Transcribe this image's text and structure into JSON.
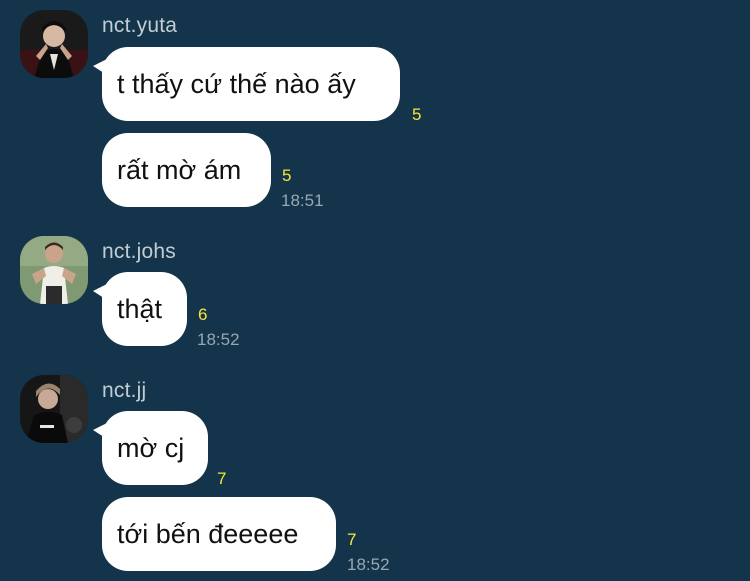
{
  "messages": [
    {
      "sender": "nct.yuta",
      "avatar_icon": "user-avatar-yuta",
      "bubbles": [
        {
          "text": "t thấy cứ thế nào ấy",
          "read_count": "5",
          "time": ""
        },
        {
          "text": "rất mờ ám",
          "read_count": "5",
          "time": "18:51"
        }
      ]
    },
    {
      "sender": "nct.johs",
      "avatar_icon": "user-avatar-johs",
      "bubbles": [
        {
          "text": "thật",
          "read_count": "6",
          "time": "18:52"
        }
      ]
    },
    {
      "sender": "nct.jj",
      "avatar_icon": "user-avatar-jj",
      "bubbles": [
        {
          "text": "mờ cj",
          "read_count": "7",
          "time": ""
        },
        {
          "text": "tới bến đeeeee",
          "read_count": "7",
          "time": "18:52"
        }
      ]
    }
  ],
  "colors": {
    "background": "#13344a",
    "bubble": "#ffffff",
    "read_count": "#f6e53a",
    "time": "#9aa7b1",
    "sender": "#c3ccd3"
  }
}
